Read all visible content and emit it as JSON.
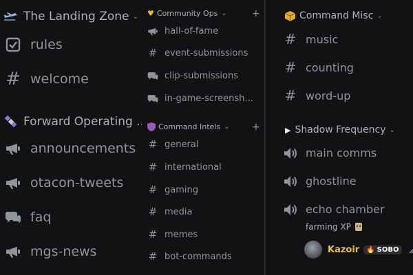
{
  "column1": {
    "categories": [
      {
        "name": "The Landing Zone"
      },
      {
        "name": "Forward Operating ..."
      }
    ],
    "channels": [
      {
        "name": "rules",
        "icon": "rules-checkbox-icon"
      },
      {
        "name": "welcome",
        "icon": "hash-icon"
      },
      {
        "name": "announcements",
        "icon": "megaphone-icon"
      },
      {
        "name": "otacon-tweets",
        "icon": "megaphone-icon"
      },
      {
        "name": "faq",
        "icon": "forum-icon"
      },
      {
        "name": "mgs-news",
        "icon": "megaphone-icon"
      }
    ]
  },
  "column2": {
    "categories": [
      {
        "name": "Community Ops"
      },
      {
        "name": "Command Intels"
      }
    ],
    "channels": [
      {
        "name": "hall-of-fame",
        "icon": "megaphone-icon"
      },
      {
        "name": "event-submissions",
        "icon": "hash-icon"
      },
      {
        "name": "clip-submissions",
        "icon": "forum-icon"
      },
      {
        "name": "in-game-screensh...",
        "icon": "forum-icon"
      },
      {
        "name": "general",
        "icon": "hash-icon"
      },
      {
        "name": "international",
        "icon": "hash-icon"
      },
      {
        "name": "gaming",
        "icon": "hash-icon"
      },
      {
        "name": "media",
        "icon": "hash-icon"
      },
      {
        "name": "memes",
        "icon": "hash-icon"
      },
      {
        "name": "bot-commands",
        "icon": "hash-icon"
      }
    ]
  },
  "column3": {
    "categories": [
      {
        "name": "Command Misc"
      },
      {
        "name": "Shadow Frequency"
      }
    ],
    "channels": [
      {
        "name": "music",
        "icon": "hash-icon"
      },
      {
        "name": "counting",
        "icon": "hash-icon"
      },
      {
        "name": "word-up",
        "icon": "hash-icon"
      },
      {
        "name": "main comms",
        "icon": "speaker-icon"
      },
      {
        "name": "ghostline",
        "icon": "speaker-icon"
      },
      {
        "name": "echo chamber",
        "icon": "speaker-icon"
      }
    ],
    "voice_status": "farming XP",
    "voice_user": {
      "name": "Kazoir",
      "badge": "SOBO"
    }
  },
  "colors": {
    "background": "#121214",
    "text_muted": "#8f939b",
    "category_text": "#aeb1b8",
    "username": "#e3c04c",
    "divider": "#2a2b30"
  }
}
